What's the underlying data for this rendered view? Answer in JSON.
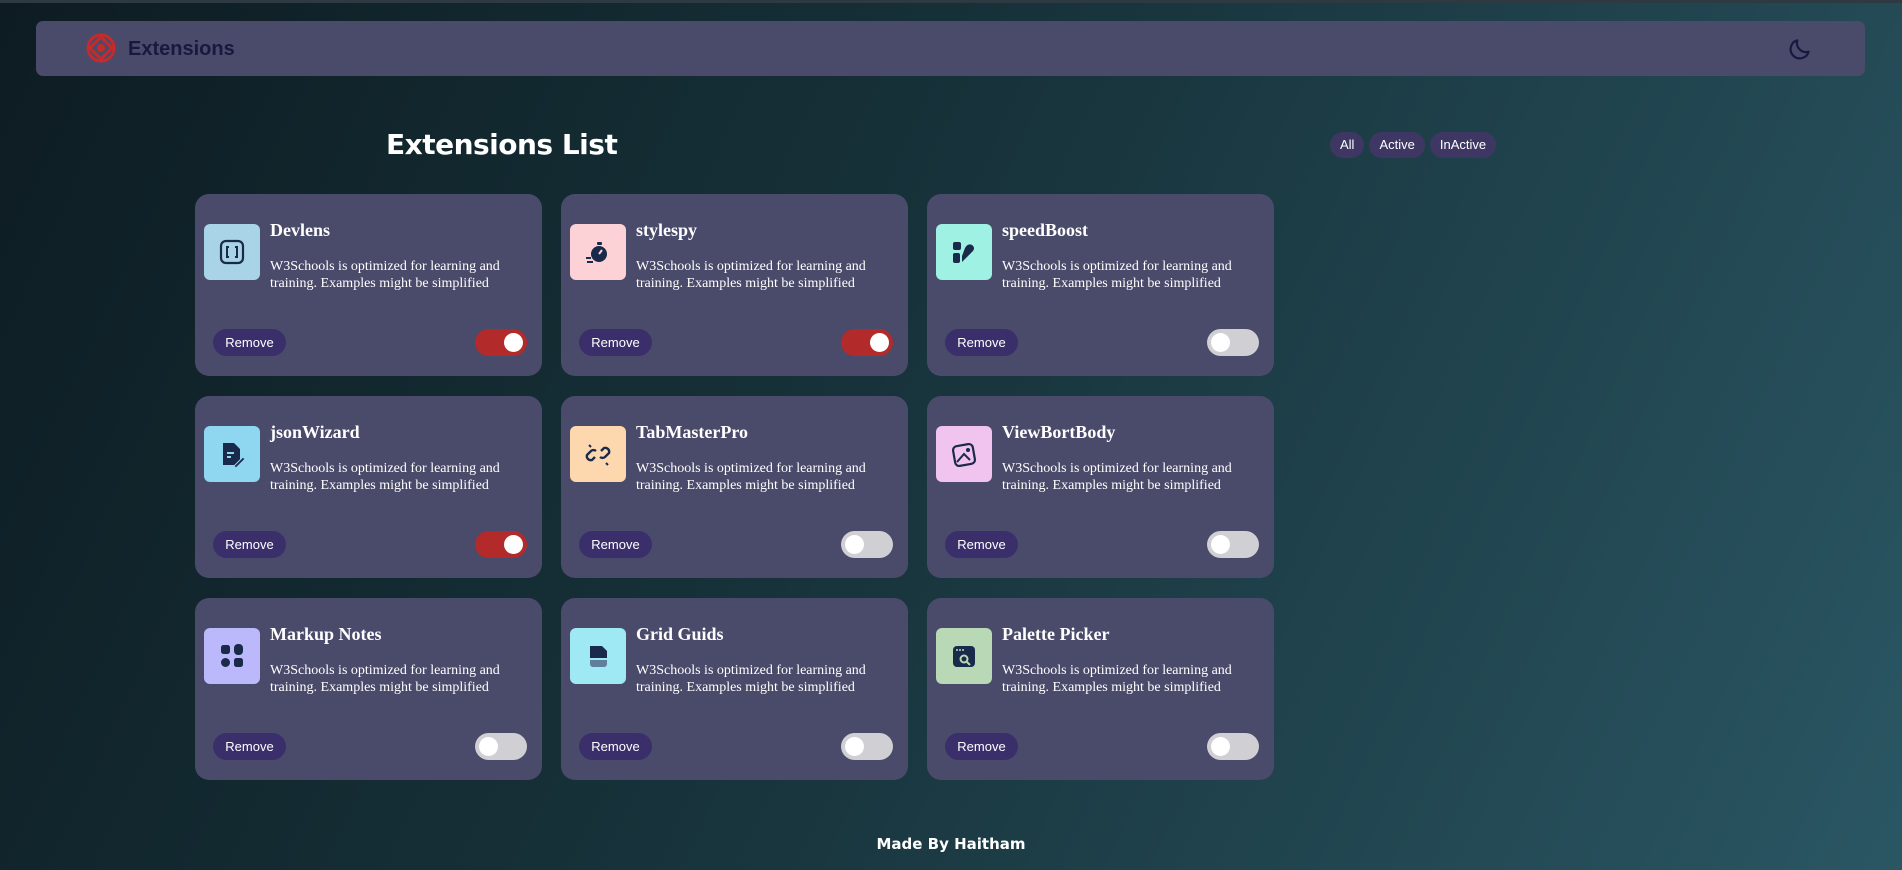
{
  "header": {
    "title": "Extensions",
    "logo_icon": "logo-icon",
    "theme_icon": "moon-icon"
  },
  "main": {
    "title": "Extensions List",
    "filters": [
      "All",
      "Active",
      "InActive"
    ]
  },
  "cards": [
    {
      "name": "Devlens",
      "description": "W3Schools is optimized for learning and training. Examples might be simplified",
      "active": true,
      "icon": "brackets-icon",
      "icon_bg": "#a9d3e6",
      "remove_label": "Remove"
    },
    {
      "name": "stylespy",
      "description": "W3Schools is optimized for learning and training. Examples might be simplified",
      "active": true,
      "icon": "stopwatch-icon",
      "icon_bg": "#fcd2d6",
      "remove_label": "Remove"
    },
    {
      "name": "speedBoost",
      "description": "W3Schools is optimized for learning and training. Examples might be simplified",
      "active": false,
      "icon": "rocket-icon",
      "icon_bg": "#9ff2e3",
      "remove_label": "Remove"
    },
    {
      "name": "jsonWizard",
      "description": "W3Schools is optimized for learning and training. Examples might be simplified",
      "active": true,
      "icon": "file-edit-icon",
      "icon_bg": "#8fd6f0",
      "remove_label": "Remove"
    },
    {
      "name": "TabMasterPro",
      "description": "W3Schools is optimized for learning and training. Examples might be simplified",
      "active": false,
      "icon": "link-icon",
      "icon_bg": "#fdd7ad",
      "remove_label": "Remove"
    },
    {
      "name": "ViewBortBody",
      "description": "W3Schools is optimized for learning and training. Examples might be simplified",
      "active": false,
      "icon": "image-frame-icon",
      "icon_bg": "#f0c4ee",
      "remove_label": "Remove"
    },
    {
      "name": "Markup Notes",
      "description": "W3Schools is optimized for learning and training. Examples might be simplified",
      "active": false,
      "icon": "grid-dots-icon",
      "icon_bg": "#bbb8fb",
      "remove_label": "Remove"
    },
    {
      "name": "Grid Guids",
      "description": "W3Schools is optimized for learning and training. Examples might be simplified",
      "active": false,
      "icon": "document-icon",
      "icon_bg": "#9fe9f4",
      "remove_label": "Remove"
    },
    {
      "name": "Palette Picker",
      "description": "W3Schools is optimized for learning and training. Examples might be simplified",
      "active": false,
      "icon": "browser-search-icon",
      "icon_bg": "#b9d8b6",
      "remove_label": "Remove"
    }
  ],
  "footer": {
    "text": "Made By Haitham"
  },
  "colors": {
    "card_bg": "#4a4a6a",
    "toggle_on": "#b22a2a",
    "toggle_off": "#cfcfd4",
    "button_bg": "#3a2f6a"
  }
}
